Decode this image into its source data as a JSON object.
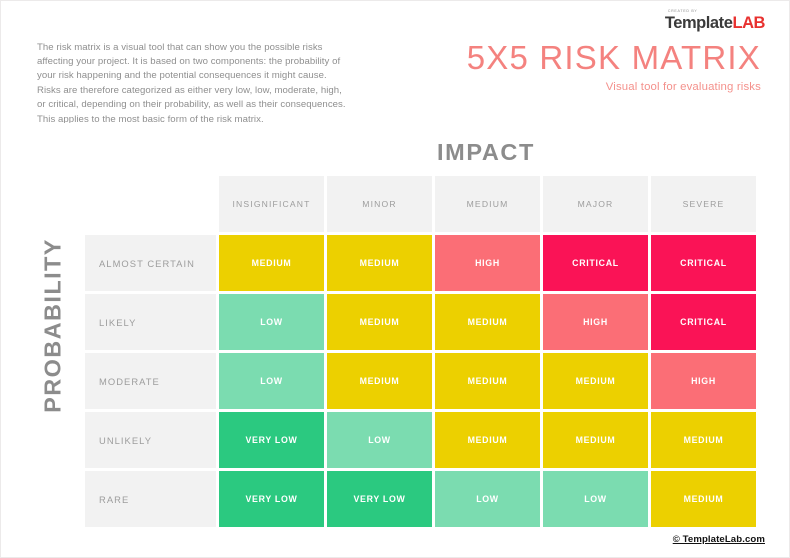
{
  "brand": {
    "kicker": "CREATED BY",
    "name_part1": "Template",
    "name_part2": "LAB"
  },
  "header": {
    "intro_paragraph": "The risk matrix is a visual tool that can show you the possible risks affecting your project. It is based on two components: the probability of your risk happening and the potential consequences it might cause. Risks are therefore categorized as either very low, low, moderate, high, or critical, depending on their probability, as well as their consequences. This applies to the most basic form of the risk matrix.",
    "title": "5X5 RISK MATRIX",
    "subtitle": "Visual tool for evaluating risks"
  },
  "axes": {
    "x_label": "IMPACT",
    "y_label": "PROBABILITY"
  },
  "footer": {
    "copyright": "© TemplateLab.com"
  },
  "colors": {
    "very_low": "#2bc980",
    "low": "#7bdcb0",
    "medium": "#ecd000",
    "high": "#fb6e76",
    "critical": "#fa1356",
    "header_bg": "#f2f2f2",
    "title": "#f4827f",
    "brand_lab": "#e8312f"
  },
  "chart_data": {
    "type": "heatmap",
    "title": "5X5 RISK MATRIX",
    "xlabel": "IMPACT",
    "ylabel": "PROBABILITY",
    "categories_x": [
      "INSIGNIFICANT",
      "MINOR",
      "MEDIUM",
      "MAJOR",
      "SEVERE"
    ],
    "categories_y": [
      "ALMOST CERTAIN",
      "LIKELY",
      "MODERATE",
      "UNLIKELY",
      "RARE"
    ],
    "legend": [
      "VERY LOW",
      "LOW",
      "MEDIUM",
      "HIGH",
      "CRITICAL"
    ],
    "rows": [
      {
        "label": "ALMOST CERTAIN",
        "cells": [
          {
            "text": "MEDIUM",
            "level": "medium"
          },
          {
            "text": "MEDIUM",
            "level": "medium"
          },
          {
            "text": "HIGH",
            "level": "high"
          },
          {
            "text": "CRITICAL",
            "level": "critical"
          },
          {
            "text": "CRITICAL",
            "level": "critical"
          }
        ]
      },
      {
        "label": "LIKELY",
        "cells": [
          {
            "text": "LOW",
            "level": "low"
          },
          {
            "text": "MEDIUM",
            "level": "medium"
          },
          {
            "text": "MEDIUM",
            "level": "medium"
          },
          {
            "text": "HIGH",
            "level": "high"
          },
          {
            "text": "CRITICAL",
            "level": "critical"
          }
        ]
      },
      {
        "label": "MODERATE",
        "cells": [
          {
            "text": "LOW",
            "level": "low"
          },
          {
            "text": "MEDIUM",
            "level": "medium"
          },
          {
            "text": "MEDIUM",
            "level": "medium"
          },
          {
            "text": "MEDIUM",
            "level": "medium"
          },
          {
            "text": "HIGH",
            "level": "high"
          }
        ]
      },
      {
        "label": "UNLIKELY",
        "cells": [
          {
            "text": "VERY LOW",
            "level": "very_low"
          },
          {
            "text": "LOW",
            "level": "low"
          },
          {
            "text": "MEDIUM",
            "level": "medium"
          },
          {
            "text": "MEDIUM",
            "level": "medium"
          },
          {
            "text": "MEDIUM",
            "level": "medium"
          }
        ]
      },
      {
        "label": "RARE",
        "cells": [
          {
            "text": "VERY LOW",
            "level": "very_low"
          },
          {
            "text": "VERY LOW",
            "level": "very_low"
          },
          {
            "text": "LOW",
            "level": "low"
          },
          {
            "text": "LOW",
            "level": "low"
          },
          {
            "text": "MEDIUM",
            "level": "medium"
          }
        ]
      }
    ]
  }
}
